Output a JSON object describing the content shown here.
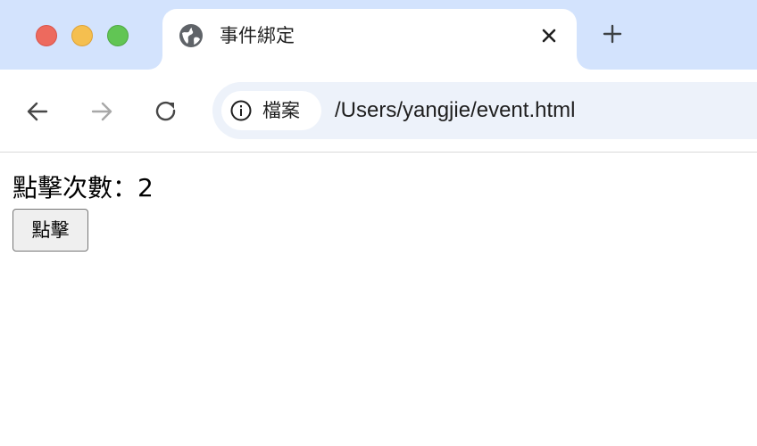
{
  "window": {
    "controls": [
      "close",
      "minimize",
      "maximize"
    ]
  },
  "tab": {
    "title": "事件綁定",
    "favicon": "globe-icon",
    "close_icon": "close-icon"
  },
  "new_tab_icon": "plus-icon",
  "toolbar": {
    "back_icon": "arrow-left-icon",
    "forward_icon": "arrow-right-icon",
    "reload_icon": "reload-icon",
    "site_info_label": "檔案",
    "site_info_icon": "info-icon",
    "url": "/Users/yangjie/event.html"
  },
  "page": {
    "counter_text": "點擊次數：2",
    "button_label": "點擊"
  },
  "colors": {
    "tabstrip_bg": "#d3e3fd",
    "omnibox_bg": "#edf2fa",
    "traffic_close": "#ed6a5e",
    "traffic_min": "#f5bf4f",
    "traffic_max": "#61c554",
    "button_bg": "#efefef"
  }
}
